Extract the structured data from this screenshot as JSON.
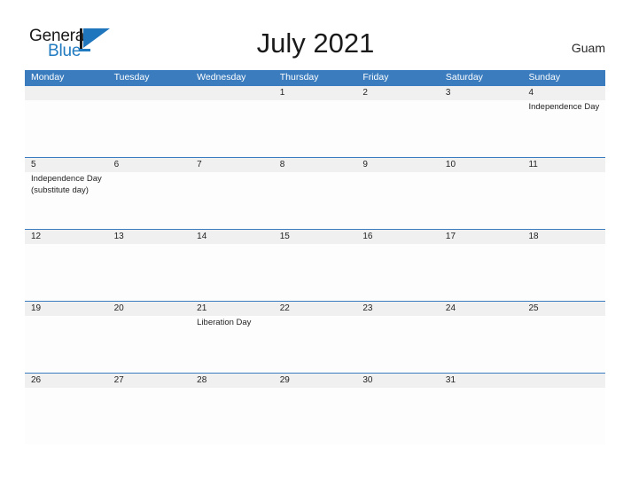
{
  "brand": {
    "name_part1": "General",
    "name_part2": "Blue",
    "mark_icon": "blue-triangle-sail-logo-icon",
    "accent_color": "#1f7ac0",
    "dark_color": "#17181a"
  },
  "header": {
    "title": "July 2021",
    "region": "Guam"
  },
  "colors": {
    "header_band": "#3a7cbe",
    "date_band": "#f0f0f0",
    "row_rule": "#3a7cbe",
    "text": "#232323",
    "page_background": "#ffffff"
  },
  "calendar": {
    "month": "July",
    "year": "2021",
    "weekday_headers": [
      "Monday",
      "Tuesday",
      "Wednesday",
      "Thursday",
      "Friday",
      "Saturday",
      "Sunday"
    ],
    "weeks": [
      {
        "days": [
          {
            "date": "",
            "events": []
          },
          {
            "date": "",
            "events": []
          },
          {
            "date": "",
            "events": []
          },
          {
            "date": "1",
            "events": []
          },
          {
            "date": "2",
            "events": []
          },
          {
            "date": "3",
            "events": []
          },
          {
            "date": "4",
            "events": [
              "Independence Day"
            ]
          }
        ]
      },
      {
        "days": [
          {
            "date": "5",
            "events": [
              "Independence Day",
              "(substitute day)"
            ]
          },
          {
            "date": "6",
            "events": []
          },
          {
            "date": "7",
            "events": []
          },
          {
            "date": "8",
            "events": []
          },
          {
            "date": "9",
            "events": []
          },
          {
            "date": "10",
            "events": []
          },
          {
            "date": "11",
            "events": []
          }
        ]
      },
      {
        "days": [
          {
            "date": "12",
            "events": []
          },
          {
            "date": "13",
            "events": []
          },
          {
            "date": "14",
            "events": []
          },
          {
            "date": "15",
            "events": []
          },
          {
            "date": "16",
            "events": []
          },
          {
            "date": "17",
            "events": []
          },
          {
            "date": "18",
            "events": []
          }
        ]
      },
      {
        "days": [
          {
            "date": "19",
            "events": []
          },
          {
            "date": "20",
            "events": []
          },
          {
            "date": "21",
            "events": [
              "Liberation Day"
            ]
          },
          {
            "date": "22",
            "events": []
          },
          {
            "date": "23",
            "events": []
          },
          {
            "date": "24",
            "events": []
          },
          {
            "date": "25",
            "events": []
          }
        ]
      },
      {
        "days": [
          {
            "date": "26",
            "events": []
          },
          {
            "date": "27",
            "events": []
          },
          {
            "date": "28",
            "events": []
          },
          {
            "date": "29",
            "events": []
          },
          {
            "date": "30",
            "events": []
          },
          {
            "date": "31",
            "events": []
          },
          {
            "date": "",
            "events": []
          }
        ]
      }
    ]
  }
}
